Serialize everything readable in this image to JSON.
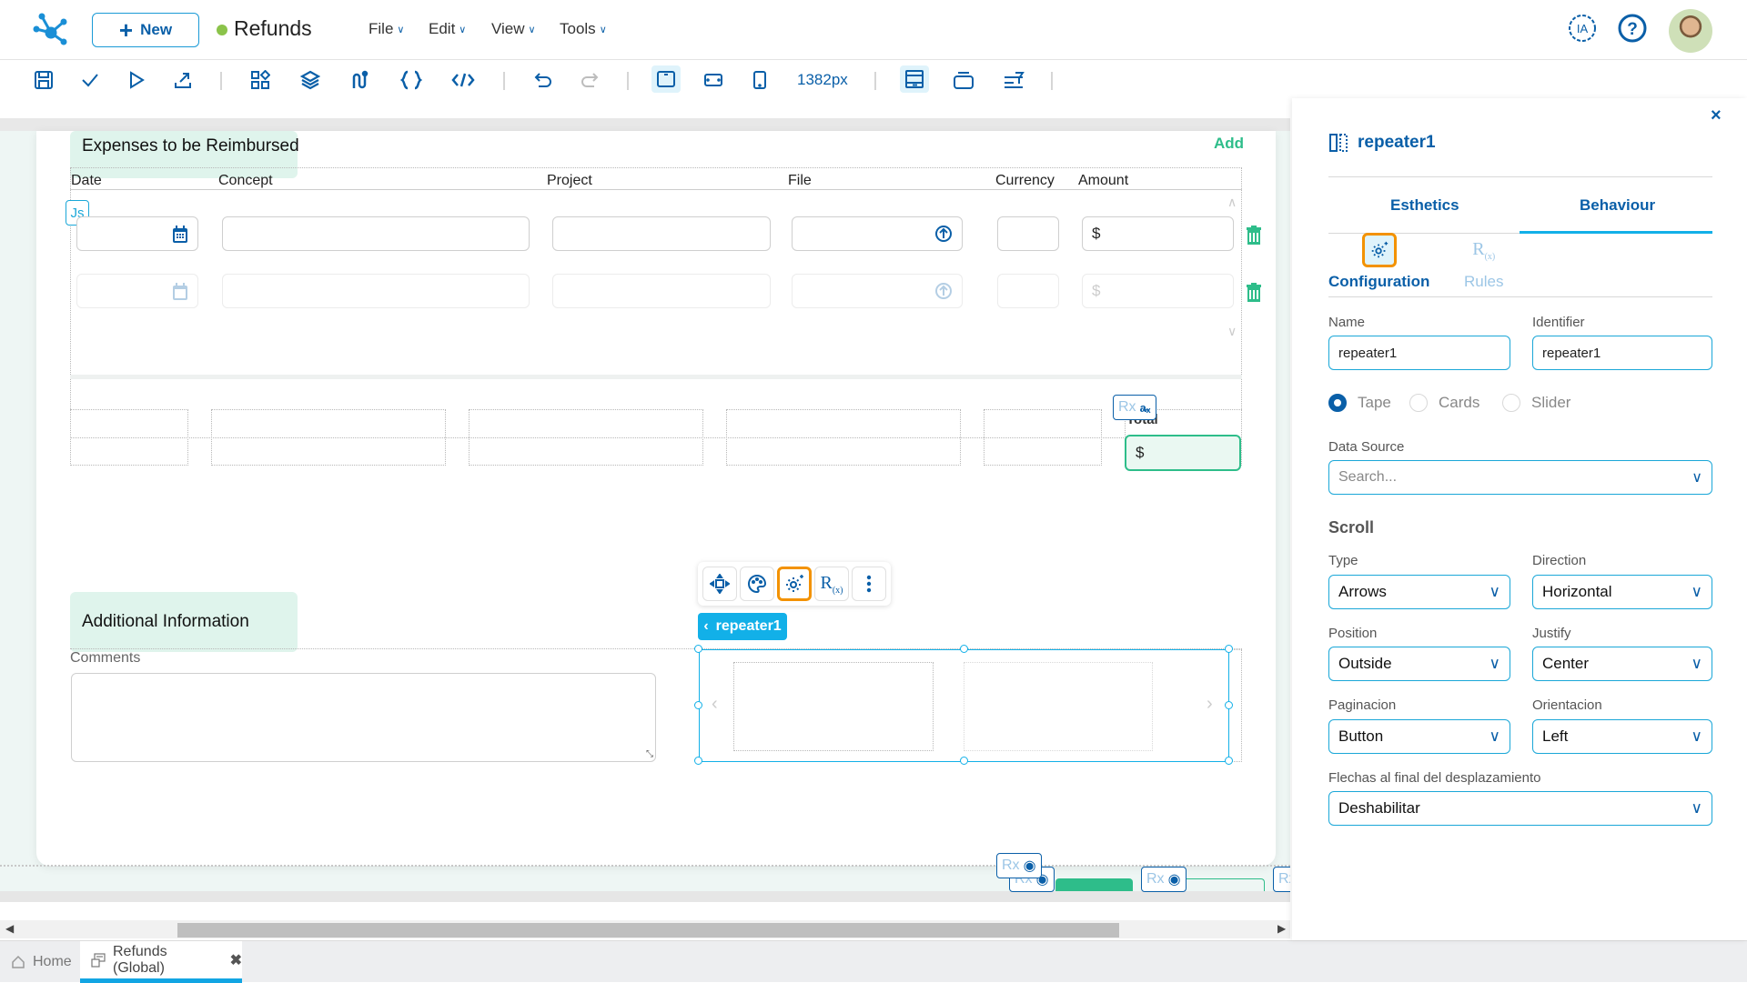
{
  "header": {
    "new_label": "New",
    "app_title": "Refunds",
    "status_color": "#8bc34a",
    "menus": [
      {
        "label": "File"
      },
      {
        "label": "Edit"
      },
      {
        "label": "View"
      },
      {
        "label": "Tools"
      }
    ],
    "ai_label": "IA",
    "help_icon": "question-circle-icon"
  },
  "toolbar": {
    "icons": [
      "save-icon",
      "check-icon",
      "play-icon",
      "export-icon",
      "components-icon",
      "layers-icon",
      "flow-icon",
      "braces-icon",
      "code-icon",
      "undo-icon",
      "redo-icon",
      "desktop-view-icon",
      "tablet-view-icon",
      "mobile-view-icon",
      "page-layout-icon",
      "container-icon",
      "filter-icon"
    ],
    "width_readout": "1382px"
  },
  "canvas": {
    "expenses": {
      "title": "Expenses to be Reimbursed",
      "add_label": "Add",
      "columns": [
        "Date",
        "Concept",
        "Project",
        "File",
        "Currency",
        "Amount"
      ],
      "rows": [
        {
          "amount_prefix": "$"
        },
        {
          "amount_prefix": "$"
        }
      ],
      "js_badge": "Js",
      "total_label": "Total",
      "total_prefix": "$",
      "rx_label": "Rx"
    },
    "additional": {
      "title": "Additional Information",
      "comments_label": "Comments"
    },
    "selection": {
      "tag_label": "repeater1",
      "toolbar": [
        "move-icon",
        "palette-icon",
        "config-gear-icon",
        "rules-rx-icon",
        "more-vertical-icon"
      ]
    },
    "rx_badges": [
      "Rx",
      "Rx",
      "Rx",
      "Rx"
    ]
  },
  "tabs": [
    {
      "label": "Home"
    },
    {
      "label": "Refunds (Global)"
    }
  ],
  "panel": {
    "title": "repeater1",
    "tabs": [
      "Esthetics",
      "Behaviour"
    ],
    "active_tab": "Behaviour",
    "subtabs": [
      "Configuration",
      "Rules"
    ],
    "name_label": "Name",
    "name_value": "repeater1",
    "identifier_label": "Identifier",
    "identifier_value": "repeater1",
    "display_options": [
      {
        "label": "Tape",
        "checked": true
      },
      {
        "label": "Cards",
        "checked": false
      },
      {
        "label": "Slider",
        "checked": false
      }
    ],
    "data_source_label": "Data Source",
    "data_source_placeholder": "Search...",
    "scroll_heading": "Scroll",
    "type_label": "Type",
    "type_value": "Arrows",
    "direction_label": "Direction",
    "direction_value": "Horizontal",
    "position_label": "Position",
    "position_value": "Outside",
    "justify_label": "Justify",
    "justify_value": "Center",
    "pagination_label": "Paginacion",
    "pagination_value": "Button",
    "orientation_label": "Orientacion",
    "orientation_value": "Left",
    "arrows_end_label": "Flechas al final del desplazamiento",
    "arrows_end_value": "Deshabilitar"
  }
}
